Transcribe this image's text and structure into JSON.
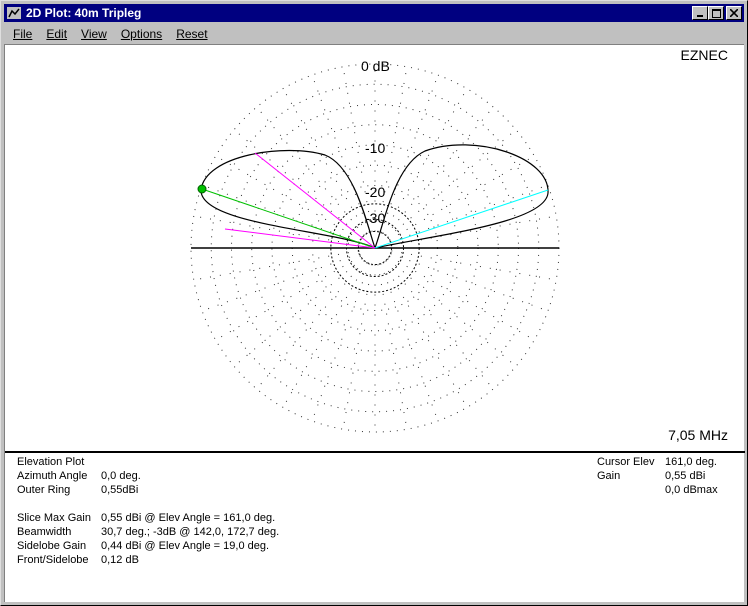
{
  "window": {
    "title": "2D Plot: 40m Tripleg"
  },
  "menu": [
    {
      "label": "File"
    },
    {
      "label": "Edit"
    },
    {
      "label": "View"
    },
    {
      "label": "Options"
    },
    {
      "label": "Reset"
    }
  ],
  "plot": {
    "brand": "EZNEC",
    "frequency": "7,05 MHz",
    "ring_labels": {
      "r0": "0 dB",
      "r10": "-10",
      "r20": "-20",
      "r30": "-30"
    }
  },
  "info": {
    "plot_type": "Elevation Plot",
    "left": [
      {
        "label": "Azimuth Angle",
        "value": "0,0 deg."
      },
      {
        "label": "Outer Ring",
        "value": "0,55dBi"
      }
    ],
    "stats": [
      {
        "label": "Slice Max Gain",
        "value": "0,55 dBi @ Elev Angle = 161,0 deg."
      },
      {
        "label": "Beamwidth",
        "value": "30,7 deg.; -3dB @ 142,0, 172,7 deg."
      },
      {
        "label": "Sidelobe Gain",
        "value": "0,44 dBi @ Elev Angle = 19,0 deg."
      },
      {
        "label": "Front/Sidelobe",
        "value": "0,12 dB"
      }
    ],
    "cursor": [
      {
        "label": "Cursor Elev",
        "value": "161,0 deg."
      },
      {
        "label": "Gain",
        "value": "0,55 dBi"
      },
      {
        "label": "",
        "value": "0,0 dBmax"
      }
    ]
  },
  "colors": {
    "titlebar": "#000080",
    "max_gain_line": "#00c000",
    "beamwidth_lines": "#ff00ff",
    "sidelobe_line": "#00ffff"
  }
}
